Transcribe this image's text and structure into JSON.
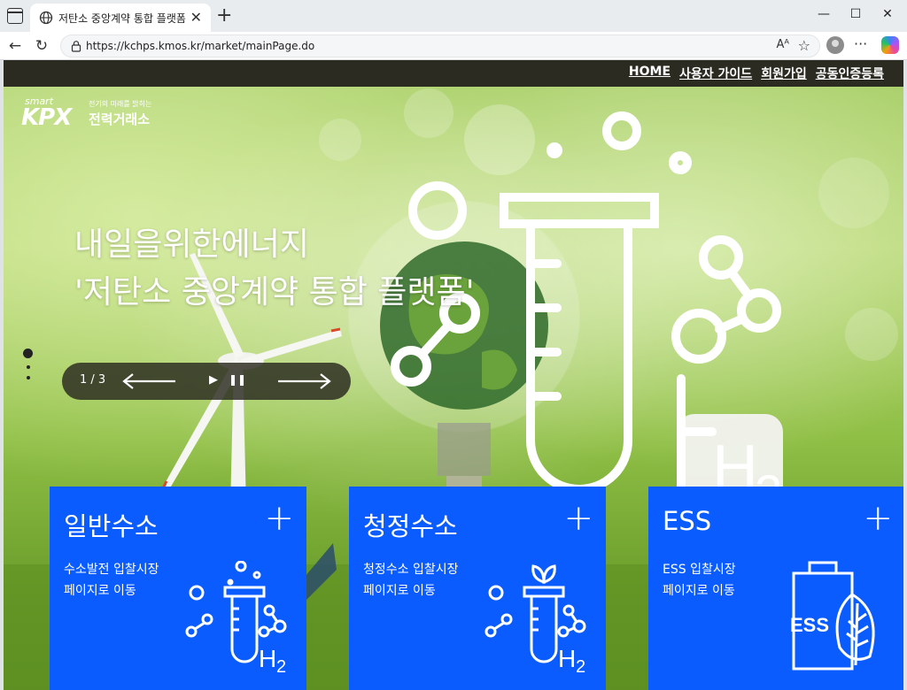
{
  "browser": {
    "tab_title": "저탄소 중앙계약 통합 플랫폼",
    "url": "https://kchps.kmos.kr/market/mainPage.do",
    "read_aloud": "Aᴬ",
    "star_icon": "☆",
    "more_icon": "···",
    "close_icon": "✕",
    "new_tab_icon": "+",
    "window_controls": {
      "minimize": "—",
      "maximize": "☐",
      "close": "✕"
    },
    "nav": {
      "back": "←",
      "refresh": "↻"
    }
  },
  "topnav": {
    "items": [
      "HOME",
      "사용자 가이드",
      "회원가입",
      "공동인증등록"
    ]
  },
  "logo": {
    "smart": "smart",
    "kpx": "KPX",
    "tagline": "전기의 미래를 밝히는",
    "name": "전력거래소"
  },
  "hero": {
    "line1": "내일을위한에너지",
    "line2": "'저탄소 중앙계약 통합 플랫폼'",
    "h2_text": "H",
    "h2_sub": "2"
  },
  "slider": {
    "counter": "1 / 3",
    "play_icon": "▶",
    "pause_icon": "❚❚"
  },
  "cards": [
    {
      "title": "일반수소",
      "plus": "+",
      "desc_line1": "수소발전 입찰시장",
      "desc_line2": "페이지로 이동",
      "icon_label": "H2"
    },
    {
      "title": "청정수소",
      "plus": "+",
      "desc_line1": "청정수소 입찰시장",
      "desc_line2": "페이지로 이동",
      "icon_label": "H2"
    },
    {
      "title": "ESS",
      "plus": "+",
      "desc_line1": "ESS 입찰시장",
      "desc_line2": "페이지로 이동",
      "icon_label": "ESS"
    }
  ]
}
